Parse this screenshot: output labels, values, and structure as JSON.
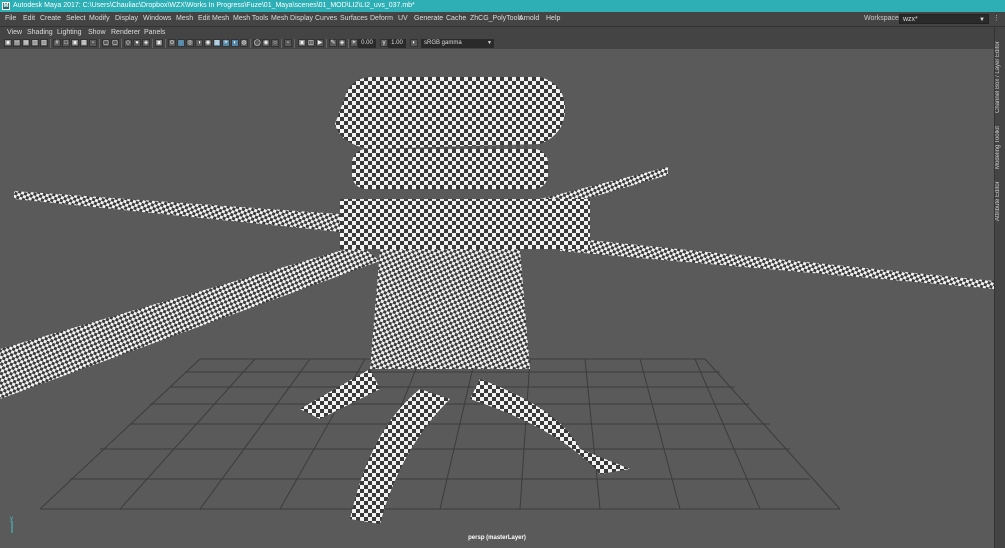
{
  "window": {
    "title": "Autodesk Maya 2017: C:\\Users\\Chauliac\\Dropbox\\WZX\\Works In Progress\\Fuze\\01_Maya\\scenes\\01_MOD\\LI2\\LI2_uvs_037.mb*",
    "logo_letter": "M"
  },
  "menubar": {
    "items": [
      "File",
      "Edit",
      "Create",
      "Select",
      "Modify",
      "Display",
      "Windows",
      "Mesh",
      "Edit Mesh",
      "Mesh Tools",
      "Mesh Display",
      "Curves",
      "Surfaces",
      "Deform",
      "UV",
      "Generate",
      "Cache",
      "ZhCG_PolyTools",
      "Arnold",
      "Help"
    ],
    "workspace_label": "Workspace :",
    "workspace_value": "wzx*"
  },
  "panel_menu": {
    "items": [
      "View",
      "Shading",
      "Lighting",
      "Show",
      "Renderer",
      "Panels"
    ]
  },
  "panel_toolbar": {
    "exposure": "0.00",
    "gamma": "1.00",
    "color_space": "sRGB gamma"
  },
  "viewport": {
    "camera_label": "persp (masterLayer)",
    "background_color": "#5a5a5a",
    "grid_color": "#3c3c3c"
  },
  "side_tabs": [
    "Channel Box / Layer Editor",
    "Modeling Toolkit",
    "Attribute Editor"
  ],
  "colors": {
    "title_bar": "#2dafb5",
    "ui_background": "#444444",
    "active_icon": "#5285a6"
  }
}
